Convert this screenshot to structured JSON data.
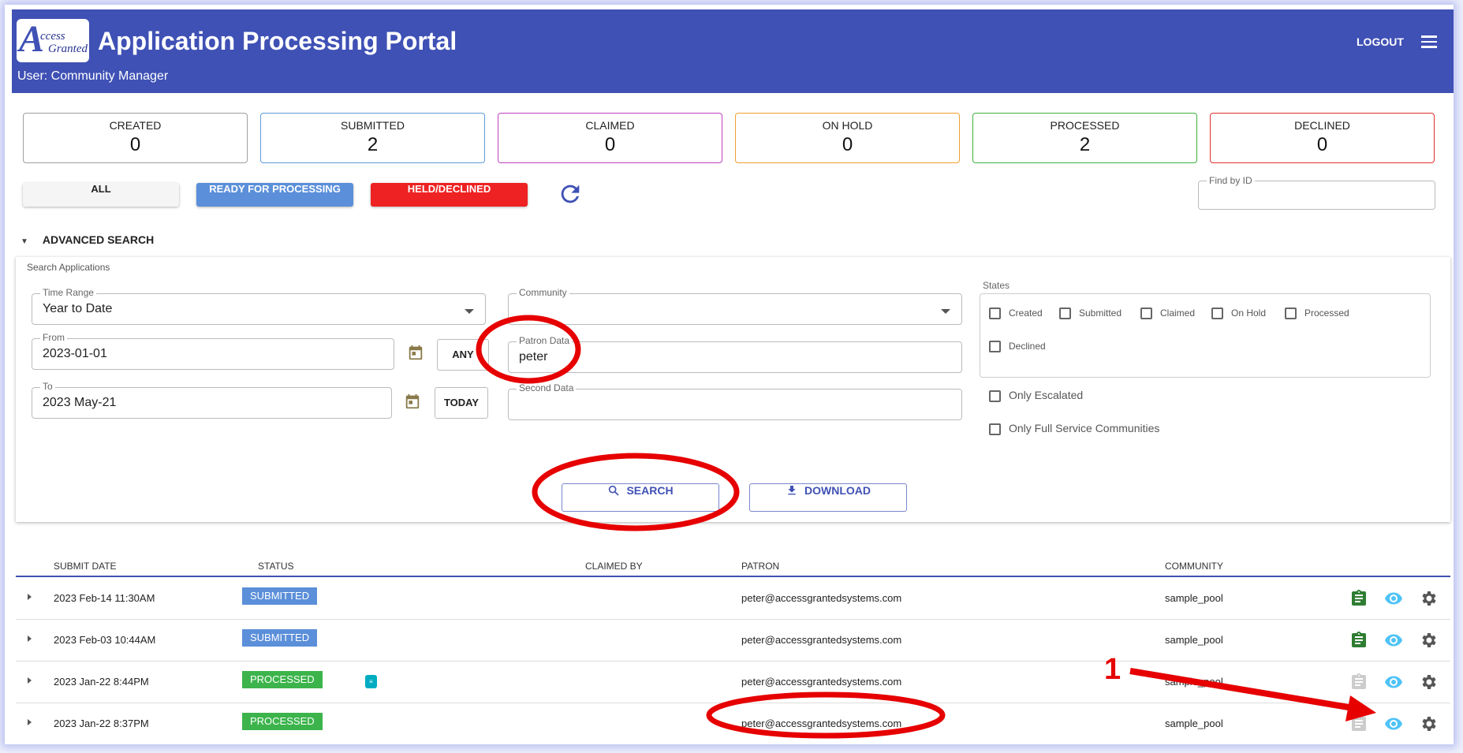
{
  "header": {
    "logo_text": "Access Granted",
    "logo_big": "A",
    "logo_sub1": "ccess",
    "logo_sub2": "Granted",
    "title": "Application Processing Portal",
    "user": "User: Community Manager",
    "logout": "LOGOUT",
    "menu_icon": "menu-icon",
    "bg_color": "#3f51b5"
  },
  "stats": [
    {
      "label": "CREATED",
      "value": "0",
      "color": "#9e9e9e"
    },
    {
      "label": "SUBMITTED",
      "value": "2",
      "color": "#5c9bd6"
    },
    {
      "label": "CLAIMED",
      "value": "0",
      "color": "#c040c0"
    },
    {
      "label": "ON HOLD",
      "value": "0",
      "color": "#f0a030"
    },
    {
      "label": "PROCESSED",
      "value": "2",
      "color": "#40b040"
    },
    {
      "label": "DECLINED",
      "value": "0",
      "color": "#e03030"
    }
  ],
  "filters": {
    "all": "ALL",
    "ready": "READY FOR PROCESSING",
    "held": "HELD/DECLINED",
    "refresh_icon": "refresh-icon",
    "find_label": "Find by ID",
    "find_value": ""
  },
  "advanced": {
    "toggle": "ADVANCED SEARCH",
    "title": "Search Applications",
    "time_range_label": "Time Range",
    "time_range_value": "Year to Date",
    "from_label": "From",
    "from_value": "2023-01-01",
    "any_button": "ANY",
    "to_label": "To",
    "to_value": "2023 May-21",
    "today_button": "TODAY",
    "community_label": "Community",
    "community_value": "",
    "patron_label": "Patron Data",
    "patron_value": "peter",
    "second_label": "Second Data",
    "second_value": "",
    "states_label": "States",
    "states": [
      "Created",
      "Submitted",
      "Claimed",
      "On Hold",
      "Processed",
      "Declined"
    ],
    "only_escalated": "Only Escalated",
    "only_full": "Only Full Service Communities",
    "search_button": "SEARCH",
    "download_button": "DOWNLOAD"
  },
  "table": {
    "columns": [
      "SUBMIT DATE",
      "STATUS",
      "CLAIMED BY",
      "PATRON",
      "COMMUNITY"
    ],
    "rows": [
      {
        "date": "2023 Feb-14 11:30AM",
        "status": "SUBMITTED",
        "status_color": "#5b8fd9",
        "claimed_by": "",
        "patron": "peter@accessgrantedsystems.com",
        "community": "sample_pool",
        "clipboard_color": "#2e7d32"
      },
      {
        "date": "2023 Feb-03 10:44AM",
        "status": "SUBMITTED",
        "status_color": "#5b8fd9",
        "claimed_by": "",
        "patron": "peter@accessgrantedsystems.com",
        "community": "sample_pool",
        "clipboard_color": "#2e7d32"
      },
      {
        "date": "2023 Jan-22 8:44PM",
        "status": "PROCESSED",
        "status_color": "#3cb44b",
        "claimed_by": "",
        "patron": "peter@accessgrantedsystems.com",
        "community": "sample_pool",
        "clipboard_color": "#cccccc"
      },
      {
        "date": "2023 Jan-22 8:37PM",
        "status": "PROCESSED",
        "status_color": "#3cb44b",
        "claimed_by": "",
        "patron": "peter@accessgrantedsystems.com",
        "community": "sample_pool",
        "clipboard_color": "#cccccc"
      }
    ]
  },
  "annotation": {
    "number": "1"
  }
}
